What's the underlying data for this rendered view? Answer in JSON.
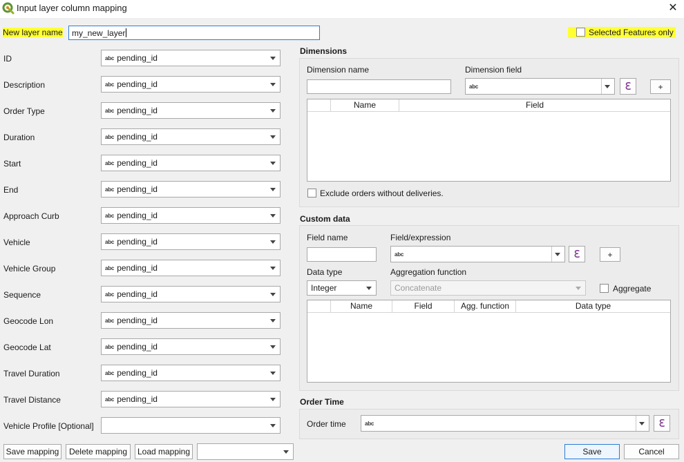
{
  "window": {
    "title": "Input layer column mapping"
  },
  "layer": {
    "name_label": "New layer name",
    "name_value": "my_new_layer",
    "selected_only_label": "Selected Features only"
  },
  "mapping": {
    "type_badge": "abc",
    "rows": [
      {
        "label": "ID",
        "value": "pending_id"
      },
      {
        "label": "Description",
        "value": "pending_id"
      },
      {
        "label": "Order Type",
        "value": "pending_id"
      },
      {
        "label": "Duration",
        "value": "pending_id"
      },
      {
        "label": "Start",
        "value": "pending_id"
      },
      {
        "label": "End",
        "value": "pending_id"
      },
      {
        "label": "Approach Curb",
        "value": "pending_id"
      },
      {
        "label": "Vehicle",
        "value": "pending_id"
      },
      {
        "label": "Vehicle Group",
        "value": "pending_id"
      },
      {
        "label": "Sequence",
        "value": "pending_id"
      },
      {
        "label": "Geocode Lon",
        "value": "pending_id"
      },
      {
        "label": "Geocode Lat",
        "value": "pending_id"
      },
      {
        "label": "Travel Duration",
        "value": "pending_id"
      },
      {
        "label": "Travel Distance",
        "value": "pending_id"
      },
      {
        "label": "Vehicle Profile [Optional]",
        "value": ""
      }
    ]
  },
  "bottom_buttons": {
    "save_mapping": "Save mapping",
    "delete_mapping": "Delete mapping",
    "load_mapping": "Load mapping",
    "save": "Save",
    "cancel": "Cancel"
  },
  "dimensions": {
    "title": "Dimensions",
    "name_label": "Dimension name",
    "field_label": "Dimension field",
    "field_badge": "abc",
    "add_label": "+",
    "columns": [
      "",
      "Name",
      "Field"
    ],
    "exclude_label": "Exclude orders without deliveries."
  },
  "custom_data": {
    "title": "Custom data",
    "field_name_label": "Field name",
    "expression_label": "Field/expression",
    "expression_badge": "abc",
    "add_label": "+",
    "data_type_label": "Data type",
    "data_type_value": "Integer",
    "aggregation_label": "Aggregation function",
    "aggregation_value": "Concatenate",
    "aggregate_label": "Aggregate",
    "columns": [
      "",
      "Name",
      "Field",
      "Agg. function",
      "Data type"
    ]
  },
  "order_time": {
    "title": "Order Time",
    "label": "Order time",
    "badge": "abc"
  },
  "icons": {
    "expression": "ℇ",
    "close": "✕"
  },
  "colors": {
    "highlight": "#ffff33",
    "focus": "#2a7bd6",
    "expression_icon": "#7a2f8c"
  }
}
